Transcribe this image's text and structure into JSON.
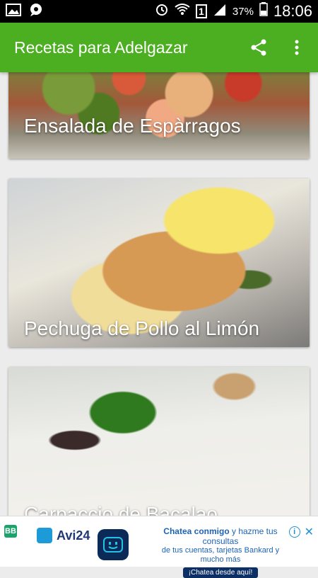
{
  "status_bar": {
    "battery": "37%",
    "time": "18:06",
    "sim": "1"
  },
  "app_bar": {
    "title": "Recetas para Adelgazar",
    "share_icon": "share-icon",
    "menu_icon": "overflow-menu-icon"
  },
  "recipes": [
    {
      "title": "Ensalada de Espàrragos"
    },
    {
      "title": "Pechuga de Pollo al Limón"
    },
    {
      "title": "Carpaccio de Bacalao"
    }
  ],
  "ad": {
    "badge": "BB",
    "brand": "Avi24",
    "headline_bold": "Chatea conmigo",
    "headline_rest": " y hazme tus consultas",
    "body": "de tus cuentas, tarjetas Bankard y mucho más",
    "cta": "¡Chatea desde aquí!",
    "info_icon": "info-icon",
    "close_icon": "close-icon"
  },
  "colors": {
    "app_bar": "#4caf22",
    "status_bar": "#000000",
    "background": "#ececec"
  }
}
